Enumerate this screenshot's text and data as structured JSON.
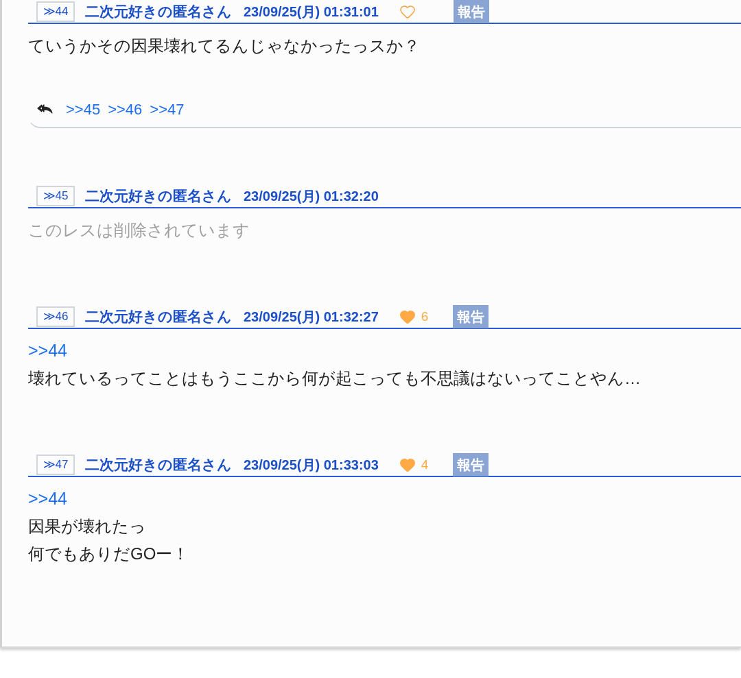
{
  "posts": [
    {
      "number": "≫44",
      "name": "二次元好きの匿名さん",
      "date": "23/09/25(月) 01:31:01",
      "deleted": false,
      "like": {
        "liked": false
      },
      "report": "報告",
      "lines": [
        {
          "kind": "text",
          "text": "ていうかその因果壊れてるんじゃなかったっスか？"
        }
      ],
      "replies": [
        ">>45",
        ">>46",
        ">>47"
      ]
    },
    {
      "number": "≫45",
      "name": "二次元好きの匿名さん",
      "date": "23/09/25(月) 01:32:20",
      "deleted": true,
      "lines": [
        {
          "kind": "text",
          "text": "このレスは削除されています"
        }
      ]
    },
    {
      "number": "≫46",
      "name": "二次元好きの匿名さん",
      "date": "23/09/25(月) 01:32:27",
      "deleted": false,
      "like": {
        "liked": true,
        "count": "6"
      },
      "report": "報告",
      "lines": [
        {
          "kind": "anchor",
          "text": ">>44"
        },
        {
          "kind": "text",
          "text": "壊れているってことはもうここから何が起こっても不思議はないってことやん…"
        }
      ]
    },
    {
      "number": "≫47",
      "name": "二次元好きの匿名さん",
      "date": "23/09/25(月) 01:33:03",
      "deleted": false,
      "like": {
        "liked": true,
        "count": "4"
      },
      "report": "報告",
      "lines": [
        {
          "kind": "anchor",
          "text": ">>44"
        },
        {
          "kind": "text",
          "text": "因果が壊れたっ"
        },
        {
          "kind": "text",
          "text": "何でもありだGOー！"
        }
      ]
    }
  ]
}
